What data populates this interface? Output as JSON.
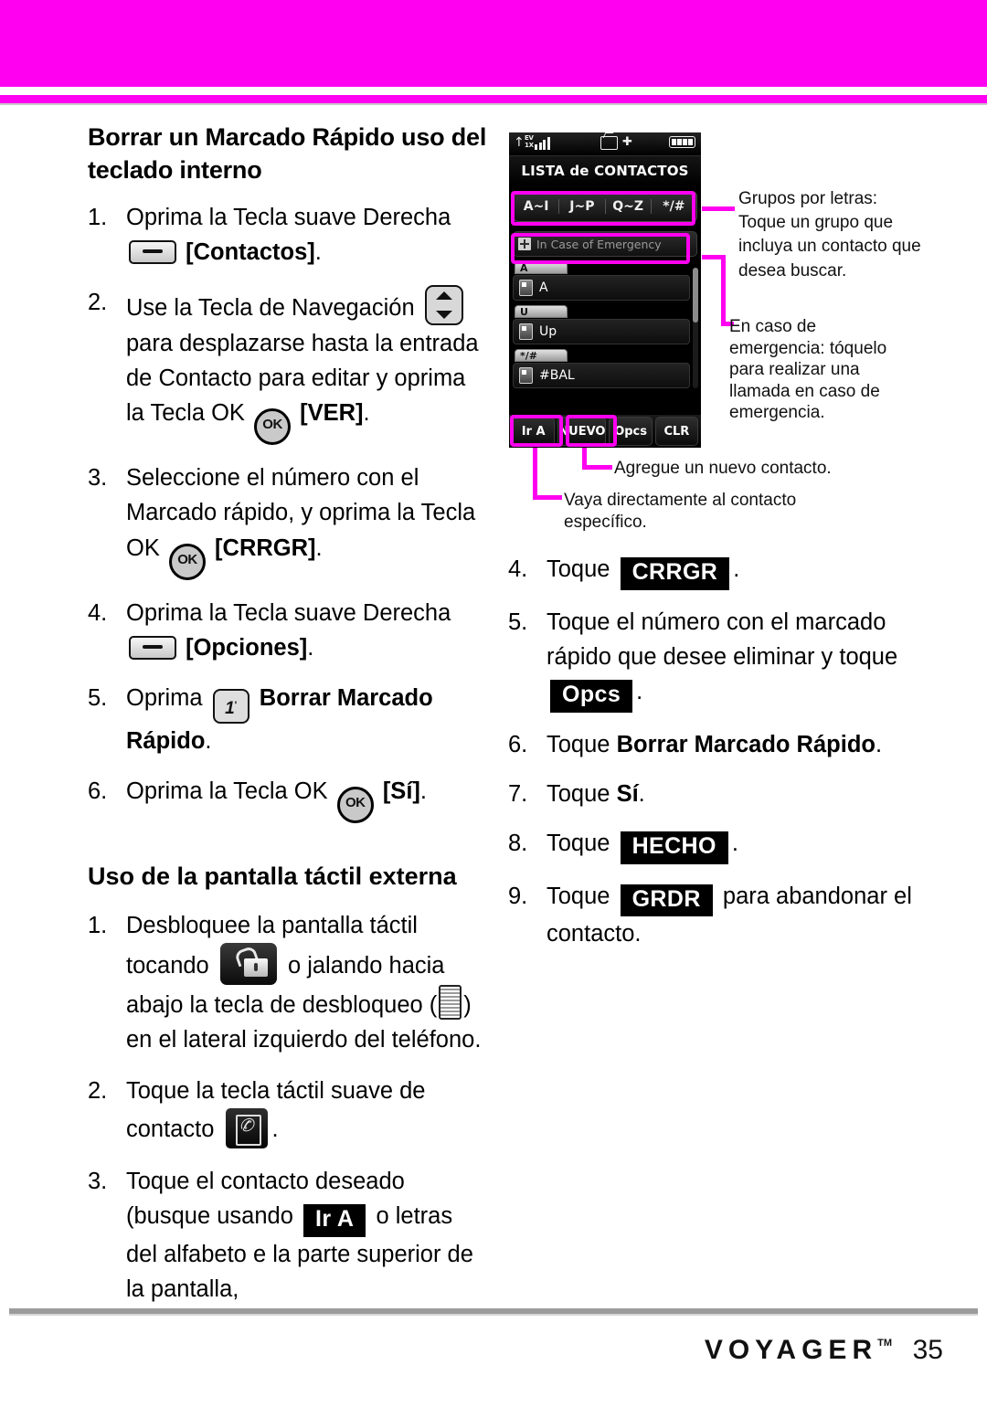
{
  "page": {
    "brand": "VOYAGER",
    "brand_tm": "TM",
    "number": "35",
    "accent_color": "#ff00f0"
  },
  "left_column": {
    "heading": "Borrar un Marcado Rápido uso del teclado interno",
    "steps": [
      {
        "num": "1.",
        "part1": "Oprima la Tecla suave Derecha",
        "key": "soft-key",
        "bold": "[Contactos]",
        "tail": "."
      },
      {
        "num": "2.",
        "part1": "Use la Tecla de Navegación",
        "key": "nav-key",
        "part2": "para desplazarse hasta la entrada de Contacto para editar y oprima la Tecla OK",
        "key2": "ok-key",
        "bold": "[VER]",
        "tail": "."
      },
      {
        "num": "3.",
        "part1": "Seleccione el número con el Marcado rápido, y oprima la Tecla OK",
        "key": "ok-key",
        "bold": "[CRRGR]",
        "tail": "."
      },
      {
        "num": "4.",
        "part1": "Oprima la Tecla suave Derecha",
        "key": "soft-key",
        "bold": "[Opciones]",
        "tail": "."
      },
      {
        "num": "5.",
        "part1": "Oprima",
        "key": "num-1-key",
        "bold": "Borrar Marcado Rápido",
        "tail": "."
      },
      {
        "num": "6.",
        "part1": "Oprima la Tecla OK",
        "key": "ok-key",
        "bold": "[Sí]",
        "tail": "."
      }
    ],
    "heading2": "Uso de la pantalla táctil externa",
    "steps2": [
      {
        "num": "1.",
        "a": "Desbloquee la pantalla táctil tocando",
        "b": "o jalando hacia abajo la tecla de desbloqueo (",
        "c": ") en el lateral izquierdo del teléfono."
      },
      {
        "num": "2.",
        "a": "Toque la tecla táctil suave de contacto",
        "b": "."
      },
      {
        "num": "3.",
        "a": "Toque el contacto deseado (busque usando",
        "pill": "Ir A",
        "b": "o letras del alfabeto e la parte superior de la pantalla,"
      }
    ],
    "ok_key_label": "OK",
    "num_key_label": "1"
  },
  "phone": {
    "status_icons": [
      "antenna-icon",
      "ev-1x-icon",
      "signal-bars-icon",
      "tv-icon",
      "gps-icon",
      "battery-icon"
    ],
    "ev_line1": "EV",
    "ev_line2": "1X",
    "title": "LISTA de CONTACTOS",
    "group_tabs": [
      "A~I",
      "J~P",
      "Q~Z",
      "*/#"
    ],
    "ice_label": "In Case of Emergency",
    "list": [
      {
        "letter": "A",
        "name": "A"
      },
      {
        "letter": "U",
        "name": "Up"
      },
      {
        "letter": "*/#",
        "name": "#BAL"
      }
    ],
    "soft_keys": [
      "Ir A",
      "NUEVO",
      "Opcs",
      "CLR"
    ]
  },
  "callouts": [
    {
      "id": "grupos",
      "text": "Grupos por letras: Toque un grupo que incluya un contacto que desea buscar."
    },
    {
      "id": "emergencia",
      "text": "En caso de emergencia: tóquelo para realizar una llamada en caso de emergencia."
    },
    {
      "id": "nuevo",
      "text": "Agregue un nuevo contacto."
    },
    {
      "id": "ira",
      "text": "Vaya directamente al contacto específico."
    }
  ],
  "right_column": {
    "steps": [
      {
        "num": "4.",
        "a": "Toque",
        "pill": "CRRGR",
        "b": "."
      },
      {
        "num": "5.",
        "a": "Toque el número con el marcado rápido que desee eliminar y toque",
        "pill": "Opcs",
        "b": "."
      },
      {
        "num": "6.",
        "a": "Toque",
        "bold": "Borrar Marcado Rápido",
        "b": "."
      },
      {
        "num": "7.",
        "a": "Toque",
        "bold": "Sí",
        "b": "."
      },
      {
        "num": "8.",
        "a": "Toque",
        "pill": "HECHO",
        "b": "."
      },
      {
        "num": "9.",
        "a": "Toque",
        "pill": "GRDR",
        "b": "para abandonar el contacto."
      }
    ]
  }
}
